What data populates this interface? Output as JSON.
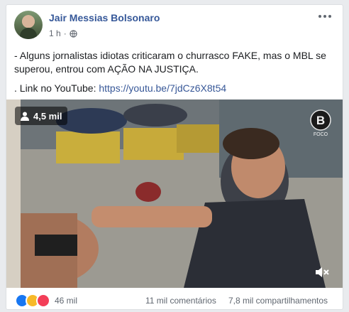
{
  "post": {
    "author": "Jair Messias Bolsonaro",
    "time": "1 h",
    "separator": "·",
    "text_line1": "- Alguns jornalistas idiotas criticaram o churrasco FAKE, mas o MBL se superou, entrou com AÇÃO NA JUSTIÇA.",
    "text_line2_prefix": ". Link no YouTube: ",
    "link": "https://youtu.be/7jdCz6X8t54"
  },
  "video": {
    "views": "4,5 mil",
    "channel_logo_letter": "B",
    "channel_logo_text": "FOCO"
  },
  "footer": {
    "reactions_count": "46 mil",
    "comments": "11 mil comentários",
    "shares": "7,8 mil compartilhamentos"
  },
  "colors": {
    "author_link": "#365899",
    "link": "#385898",
    "like": "#1877f2",
    "haha": "#f7b928",
    "love": "#f33e58"
  },
  "icons": [
    "globe-icon",
    "more-options-icon",
    "person-icon",
    "mute-icon",
    "like-icon",
    "haha-icon",
    "love-icon"
  ]
}
